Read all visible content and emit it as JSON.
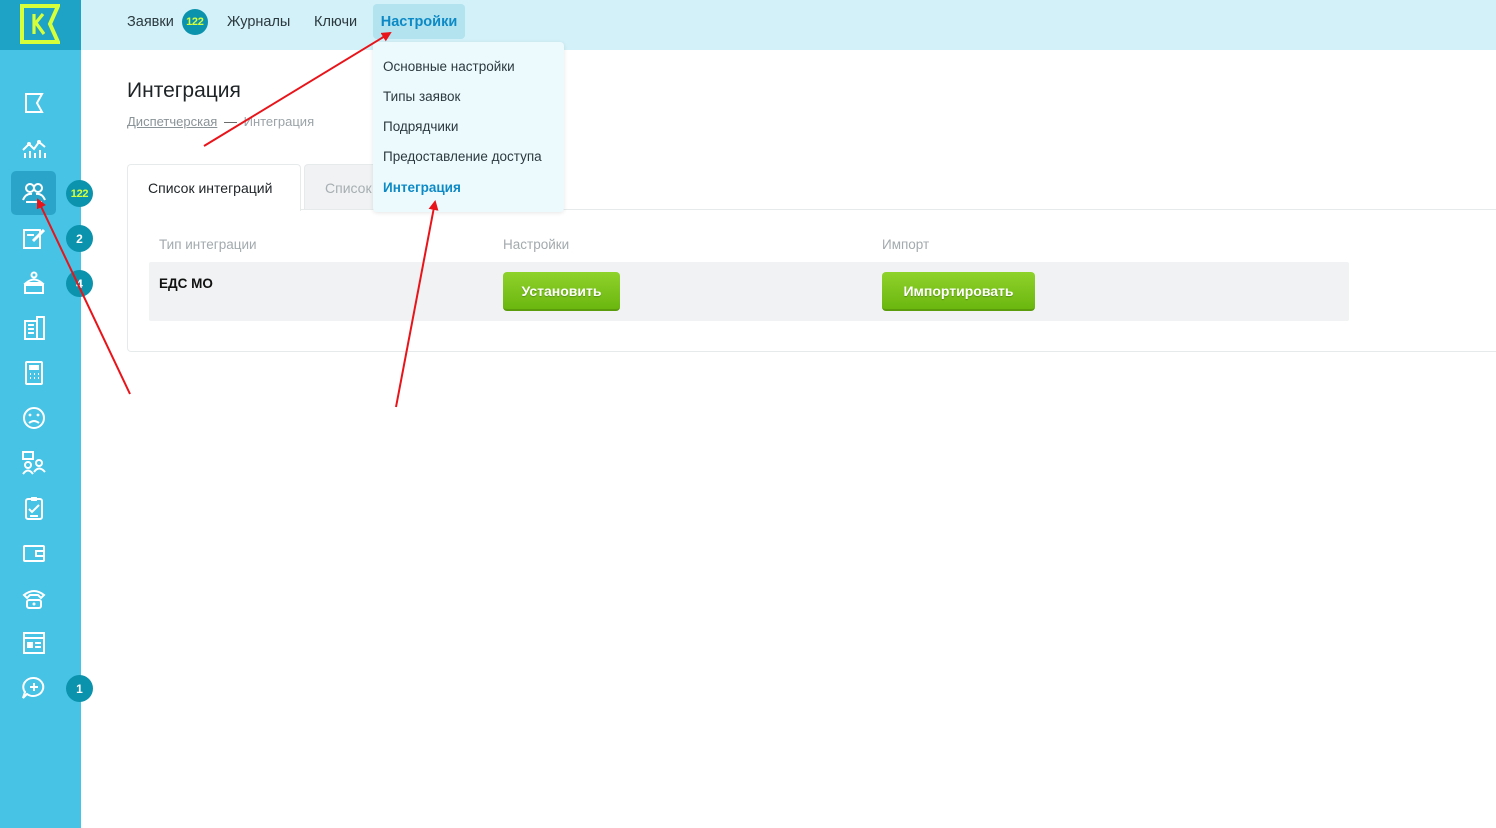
{
  "colors": {
    "sidebar": "#47c3e6",
    "topbar": "#d3f1f8",
    "badge": "#0b93ad",
    "badge_text_accent": "#d6ff3a",
    "active_link": "#0d8ac6",
    "button_green": "#7ec61e",
    "arrow": "#e8141a"
  },
  "sidebar": {
    "items": [
      {
        "icon": "flag-icon"
      },
      {
        "icon": "analytics-icon"
      },
      {
        "icon": "dispatcher-icon",
        "badge": "122"
      },
      {
        "icon": "edit-doc-icon",
        "badge": "2"
      },
      {
        "icon": "worker-icon",
        "badge": "4"
      },
      {
        "icon": "building-icon"
      },
      {
        "icon": "calculator-icon"
      },
      {
        "icon": "sad-face-icon"
      },
      {
        "icon": "residents-icon"
      },
      {
        "icon": "checklist-icon"
      },
      {
        "icon": "wallet-icon"
      },
      {
        "icon": "phone-icon"
      },
      {
        "icon": "card-icon"
      },
      {
        "icon": "chat-plus-icon",
        "badge": "1"
      }
    ]
  },
  "topnav": {
    "requests": "Заявки",
    "requests_badge": "122",
    "journals": "Журналы",
    "keys": "Ключи",
    "settings": "Настройки"
  },
  "dropdown": {
    "items": [
      "Основные настройки",
      "Типы заявок",
      "Подрядчики",
      "Предоставление доступа",
      "Интеграция"
    ]
  },
  "page": {
    "title": "Интеграция",
    "breadcrumb_link": "Диспетчерская",
    "breadcrumb_sep": "—",
    "breadcrumb_current": "Интеграция"
  },
  "tabs": {
    "list": "Список интеграций",
    "other": "Список"
  },
  "table": {
    "headers": [
      "Тип интеграции",
      "Настройки",
      "Импорт"
    ],
    "rows": [
      {
        "name": "ЕДС МО",
        "settings_button": "Установить",
        "import_button": "Импортировать"
      }
    ]
  }
}
